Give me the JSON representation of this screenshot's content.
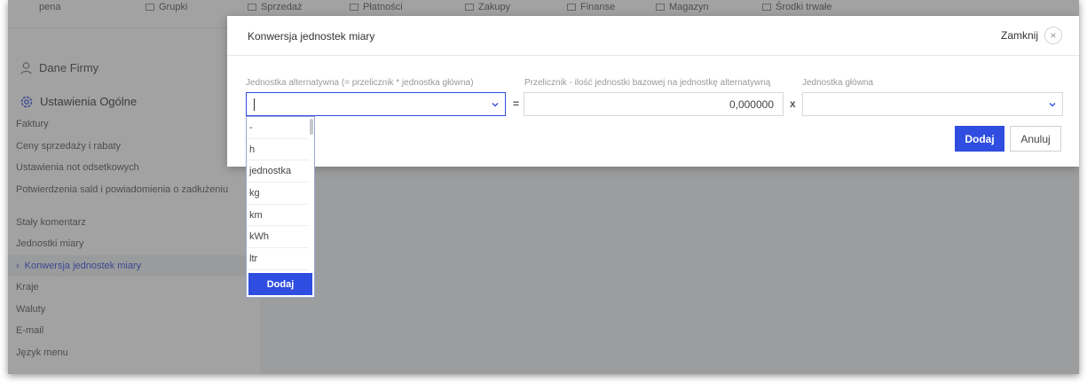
{
  "topnav": {
    "items": [
      {
        "label": "pena",
        "icon": "none"
      },
      {
        "label": "Grupki",
        "icon": "group-icon"
      },
      {
        "label": "Sprzedaż",
        "icon": "cart-icon"
      },
      {
        "label": "Płatności",
        "icon": "payments-icon"
      },
      {
        "label": "Zakupy",
        "icon": "purchase-icon"
      },
      {
        "label": "Finanse",
        "icon": "finance-icon"
      },
      {
        "label": "Magazyn",
        "icon": "warehouse-icon"
      },
      {
        "label": "Środki trwałe",
        "icon": "assets-icon"
      }
    ]
  },
  "sidebar": {
    "firm_label": "Dane Firmy",
    "general_label": "Ustawienia Ogólne",
    "items": [
      "Faktury",
      "Ceny sprzedaży i rabaty",
      "Ustawienia not odsetkowych",
      "Potwierdzenia sald i powiadomienia o zadłużeniu",
      "Stały komentarz",
      "Jednostki miary",
      "Konwersja jednostek miary",
      "Kraje",
      "Waluty",
      "E-mail",
      "Język menu"
    ],
    "active_index": 6
  },
  "modal": {
    "title": "Konwersja jednostek miary",
    "close_label": "Zamknij",
    "alt_unit_label": "Jednostka alternatywna (= przelicznik * jednostka główna)",
    "factor_label": "Przelicznik - ilość jednostki bazowej na jednostkę alternatywną",
    "main_unit_label": "Jednostka główna",
    "alt_unit_value": "",
    "factor_value": "0,000000",
    "main_unit_value": "",
    "equals_sign": "=",
    "times_sign": "x",
    "add_button": "Dodaj",
    "cancel_button": "Anuluj"
  },
  "dropdown": {
    "options": [
      "-",
      "h",
      "jednostka",
      "kg",
      "km",
      "kWh",
      "ltr"
    ],
    "add_button": "Dodaj"
  },
  "colors": {
    "accent": "#2f4de0",
    "overlay": "#464646"
  }
}
